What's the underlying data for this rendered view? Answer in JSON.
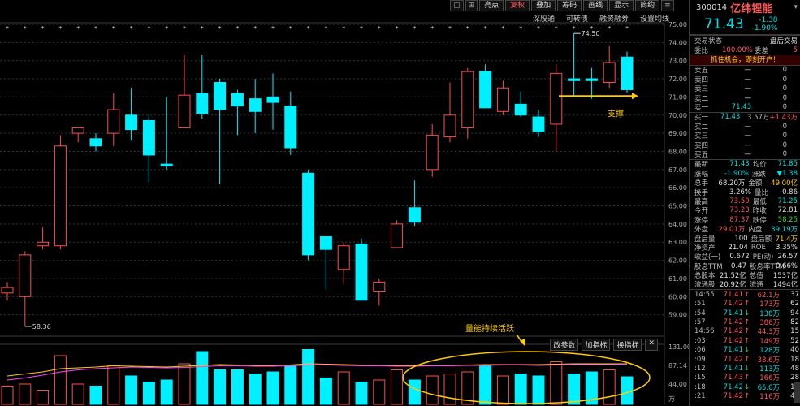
{
  "toolbar": {
    "items": [
      "亮点",
      "复权",
      "叠加",
      "筹码",
      "画线",
      "显示",
      "简约"
    ],
    "active": "复权",
    "subitems": [
      "深股通",
      "可转债",
      "融资融券",
      "设置均线"
    ]
  },
  "volume_tools": [
    "改参数",
    "加指标",
    "换指标"
  ],
  "annotations": {
    "high_label": "74.50",
    "low_label": "58.36",
    "support": "支撑",
    "volume_note": "量能持续活跃"
  },
  "stock": {
    "code": "300014",
    "name": "亿纬锂能",
    "price": "71.43",
    "change": "-1.38",
    "change_pct": "-1.90%",
    "status_label": "交易状态",
    "status_value": "盘后交易",
    "weibi_label": "委比",
    "weibi_value": "100.00%",
    "weicha_label": "委差",
    "weicha_value": "5",
    "promo": "抓住机会，即刻开户！"
  },
  "order_book": [
    {
      "label": "卖五",
      "price": "—",
      "vol": "0",
      "extra": ""
    },
    {
      "label": "卖四",
      "price": "—",
      "vol": "0",
      "extra": ""
    },
    {
      "label": "卖三",
      "price": "—",
      "vol": "0",
      "extra": ""
    },
    {
      "label": "卖二",
      "price": "—",
      "vol": "0",
      "extra": ""
    },
    {
      "label": "卖一",
      "price": "71.43",
      "vol": "0",
      "extra": ""
    },
    {
      "label": "买一",
      "price": "71.43",
      "vol": "3.57万",
      "extra": "+1.43万"
    },
    {
      "label": "买二",
      "price": "—",
      "vol": "0",
      "extra": ""
    },
    {
      "label": "买三",
      "price": "—",
      "vol": "0",
      "extra": ""
    },
    {
      "label": "买四",
      "price": "—",
      "vol": "0",
      "extra": ""
    },
    {
      "label": "买五",
      "price": "—",
      "vol": "0",
      "extra": ""
    }
  ],
  "stats": [
    {
      "l1": "最新",
      "v1": "71.43",
      "c1": "cyan",
      "l2": "均价",
      "v2": "71.85",
      "c2": "cyan"
    },
    {
      "l1": "涨幅",
      "v1": "-1.90%",
      "c1": "cyan",
      "l2": "涨跌",
      "v2": "▼1.38",
      "c2": "cyan"
    },
    {
      "l1": "总手",
      "v1": "68.20万",
      "c1": "wht",
      "l2": "金额",
      "v2": "49.00亿",
      "c2": "yel"
    },
    {
      "l1": "换手",
      "v1": "3.26%",
      "c1": "wht",
      "l2": "量比",
      "v2": "0.86",
      "c2": "wht"
    },
    {
      "l1": "最高",
      "v1": "73.50",
      "c1": "red",
      "l2": "最低",
      "v2": "71.25",
      "c2": "cyan"
    },
    {
      "l1": "今开",
      "v1": "73.23",
      "c1": "red",
      "l2": "昨收",
      "v2": "72.81",
      "c2": "wht"
    },
    {
      "l1": "涨停",
      "v1": "87.37",
      "c1": "red",
      "l2": "跌停",
      "v2": "58.25",
      "c2": "green"
    },
    {
      "l1": "外盘",
      "v1": "29.01万",
      "c1": "red",
      "l2": "内盘",
      "v2": "39.19万",
      "c2": "cyan"
    },
    {
      "l1": "盘后量",
      "v1": "100",
      "c1": "wht",
      "l2": "盘后额",
      "v2": "71.4万",
      "c2": "yel"
    },
    {
      "l1": "净资产",
      "v1": "21.04",
      "c1": "wht",
      "l2": "ROE",
      "v2": "3.35%",
      "c2": "wht"
    },
    {
      "l1": "收益(一)",
      "v1": "0.672",
      "c1": "wht",
      "l2": "PE(动)",
      "v2": "26.57",
      "c2": "wht"
    },
    {
      "l1": "股息TTM",
      "v1": "0.47",
      "c1": "wht",
      "l2": "股息率TTM",
      "v2": "0.66%",
      "c2": "wht"
    },
    {
      "l1": "总股本",
      "v1": "21.52亿",
      "c1": "wht",
      "l2": "总值",
      "v2": "1537亿",
      "c2": "wht"
    },
    {
      "l1": "流通股",
      "v1": "20.92亿",
      "c1": "wht",
      "l2": "流通",
      "v2": "1494亿",
      "c2": "wht"
    }
  ],
  "ticks": [
    {
      "t": "14:55",
      "p": "71.41",
      "d": "up",
      "v": "62.1万",
      "n": "37"
    },
    {
      "t": ":51",
      "p": "71.42",
      "d": "up",
      "v": "173万",
      "n": "62"
    },
    {
      "t": ":54",
      "p": "71.41",
      "d": "down",
      "v": "138万",
      "n": "94"
    },
    {
      "t": ":57",
      "p": "71.42",
      "d": "up",
      "v": "386万",
      "n": "82"
    },
    {
      "t": "14:56",
      "p": "71.42",
      "d": "up",
      "v": "44.3万",
      "n": "15"
    },
    {
      "t": ":03",
      "p": "71.42",
      "d": "up",
      "v": "149万",
      "n": "52"
    },
    {
      "t": ":06",
      "p": "71.41",
      "d": "down",
      "v": "128万",
      "n": "40"
    },
    {
      "t": ":09",
      "p": "71.42",
      "d": "up",
      "v": "38.6万",
      "n": "18"
    },
    {
      "t": ":12",
      "p": "71.41",
      "d": "down",
      "v": "113万",
      "n": "48"
    },
    {
      "t": ":15",
      "p": "71.43",
      "d": "up",
      "v": "166万",
      "n": "28"
    },
    {
      "t": ":18",
      "p": "71.42",
      "d": "down",
      "v": "65.0万",
      "n": "15"
    },
    {
      "t": ":21",
      "p": "71.42",
      "d": "up",
      "v": "116万",
      "n": "47"
    }
  ],
  "chart_data": {
    "type": "candlestick",
    "ylim": [
      58,
      75
    ],
    "y_ticks": [
      "75.00",
      "74.00",
      "73.00",
      "72.00",
      "71.00",
      "70.00",
      "69.00",
      "68.00",
      "67.00",
      "66.00",
      "65.00",
      "64.00",
      "63.00",
      "62.00",
      "61.00",
      "60.00",
      "59.00"
    ],
    "volume_ticks": [
      "131.00",
      "87.14",
      "44.00",
      "万"
    ],
    "candles": [
      {
        "o": 60.2,
        "c": 60.5,
        "h": 60.8,
        "l": 59.8
      },
      {
        "o": 60.0,
        "c": 62.3,
        "h": 62.5,
        "l": 58.36
      },
      {
        "o": 62.8,
        "c": 63.0,
        "h": 63.8,
        "l": 62.6
      },
      {
        "o": 62.8,
        "c": 68.3,
        "h": 68.9,
        "l": 62.6
      },
      {
        "o": 69.0,
        "c": 69.3,
        "h": 69.3,
        "l": 68.5
      },
      {
        "o": 68.7,
        "c": 68.3,
        "h": 69.0,
        "l": 68.0
      },
      {
        "o": 69.0,
        "c": 70.3,
        "h": 71.2,
        "l": 68.3
      },
      {
        "o": 70.0,
        "c": 69.2,
        "h": 71.5,
        "l": 68.6
      },
      {
        "o": 69.7,
        "c": 67.8,
        "h": 70.0,
        "l": 66.3
      },
      {
        "o": 67.3,
        "c": 67.2,
        "h": 71.0,
        "l": 67.0
      },
      {
        "o": 69.3,
        "c": 71.1,
        "h": 73.3,
        "l": 69.3
      },
      {
        "o": 71.2,
        "c": 70.1,
        "h": 73.3,
        "l": 69.8
      },
      {
        "o": 71.8,
        "c": 70.3,
        "h": 72.0,
        "l": 66.2
      },
      {
        "o": 71.2,
        "c": 70.5,
        "h": 71.4,
        "l": 68.9
      },
      {
        "o": 70.9,
        "c": 70.2,
        "h": 72.0,
        "l": 69.0
      },
      {
        "o": 71.0,
        "c": 70.7,
        "h": 72.3,
        "l": 69.2
      },
      {
        "o": 70.5,
        "c": 68.2,
        "h": 71.3,
        "l": 67.8
      },
      {
        "o": 66.8,
        "c": 62.3,
        "h": 67.0,
        "l": 62.0
      },
      {
        "o": 63.3,
        "c": 62.6,
        "h": 63.3,
        "l": 60.4
      },
      {
        "o": 61.5,
        "c": 62.8,
        "h": 63.0,
        "l": 60.7
      },
      {
        "o": 62.9,
        "c": 59.8,
        "h": 63.2,
        "l": 59.8
      },
      {
        "o": 60.3,
        "c": 60.8,
        "h": 61.0,
        "l": 59.5
      },
      {
        "o": 62.7,
        "c": 64.0,
        "h": 64.2,
        "l": 62.7
      },
      {
        "o": 64.9,
        "c": 64.1,
        "h": 66.4,
        "l": 63.9
      },
      {
        "o": 67.0,
        "c": 68.9,
        "h": 69.5,
        "l": 66.6
      },
      {
        "o": 68.8,
        "c": 70.0,
        "h": 71.8,
        "l": 68.5
      },
      {
        "o": 69.3,
        "c": 72.4,
        "h": 72.6,
        "l": 68.7
      },
      {
        "o": 72.4,
        "c": 70.4,
        "h": 72.8,
        "l": 70.4
      },
      {
        "o": 70.2,
        "c": 71.5,
        "h": 71.9,
        "l": 70.0
      },
      {
        "o": 70.6,
        "c": 70.0,
        "h": 71.3,
        "l": 69.9
      },
      {
        "o": 69.9,
        "c": 69.1,
        "h": 70.3,
        "l": 68.8
      },
      {
        "o": 69.5,
        "c": 72.3,
        "h": 72.8,
        "l": 68.0
      },
      {
        "o": 72.0,
        "c": 71.9,
        "h": 74.5,
        "l": 71.0
      },
      {
        "o": 72.0,
        "c": 71.9,
        "h": 72.6,
        "l": 70.9
      },
      {
        "o": 71.8,
        "c": 72.9,
        "h": 73.8,
        "l": 71.5
      },
      {
        "o": 73.2,
        "c": 71.4,
        "h": 73.5,
        "l": 71.25
      }
    ],
    "volumes": [
      45,
      50,
      35,
      120,
      50,
      45,
      95,
      70,
      55,
      60,
      100,
      130,
      85,
      85,
      75,
      80,
      95,
      135,
      65,
      80,
      55,
      60,
      85,
      60,
      70,
      75,
      80,
      95,
      70,
      75,
      70,
      105,
      75,
      80,
      85,
      68
    ],
    "ma_line": [
      70,
      75,
      80,
      88,
      90,
      92,
      95,
      94,
      93,
      92,
      94,
      96,
      98,
      97,
      96,
      96,
      97,
      100,
      99,
      98,
      97,
      96,
      96,
      96,
      96,
      96,
      97,
      98,
      98,
      98,
      98,
      99,
      100,
      100,
      100,
      100
    ],
    "ma_line2": [
      60,
      65,
      72,
      80,
      85,
      88,
      90,
      92,
      91,
      90,
      91,
      93,
      95,
      95,
      94,
      94,
      95,
      97,
      97,
      96,
      95,
      95,
      94,
      94,
      95,
      95,
      96,
      96,
      97,
      97,
      96,
      97,
      98,
      98,
      98,
      99
    ]
  }
}
